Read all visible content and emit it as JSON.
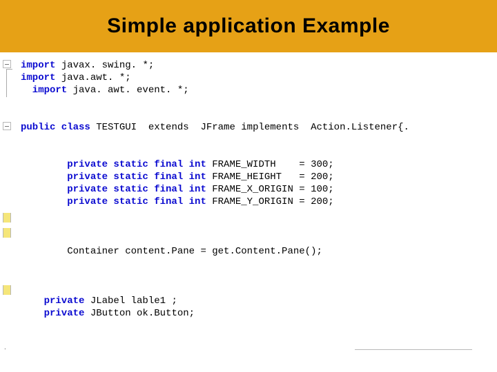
{
  "banner": {
    "title": "Simple application Example"
  },
  "code": {
    "lines": [
      {
        "kw": "import",
        "rest": " javax. swing. *;"
      },
      {
        "kw": "import",
        "rest": " java.awt. *;"
      },
      {
        "kw": "  import",
        "rest": " java. awt. event. *;"
      },
      {
        "kw": "",
        "rest": ""
      },
      {
        "kw": "",
        "rest": ""
      },
      {
        "kw": "public class",
        "rest": " TESTGUI  extends  JFrame implements  Action.Listener{."
      },
      {
        "kw": "",
        "rest": ""
      },
      {
        "kw": "",
        "rest": ""
      },
      {
        "kw": "        private static final int",
        "rest": " FRAME_WIDTH    = 300;"
      },
      {
        "kw": "        private static final int",
        "rest": " FRAME_HEIGHT   = 200;"
      },
      {
        "kw": "        private static final int",
        "rest": " FRAME_X_ORIGIN = 100;"
      },
      {
        "kw": "        private static final int",
        "rest": " FRAME_Y_ORIGIN = 200;"
      },
      {
        "kw": "",
        "rest": ""
      },
      {
        "kw": "",
        "rest": ""
      },
      {
        "kw": "",
        "rest": ""
      },
      {
        "kw": "",
        "rest": "        Container content.Pane = get.Content.Pane();"
      },
      {
        "kw": "",
        "rest": ""
      },
      {
        "kw": "",
        "rest": ""
      },
      {
        "kw": "",
        "rest": ""
      },
      {
        "kw": "    private",
        "rest": " JLabel lable1 ;"
      },
      {
        "kw": "    private",
        "rest": " JButton ok.Button;"
      }
    ]
  }
}
